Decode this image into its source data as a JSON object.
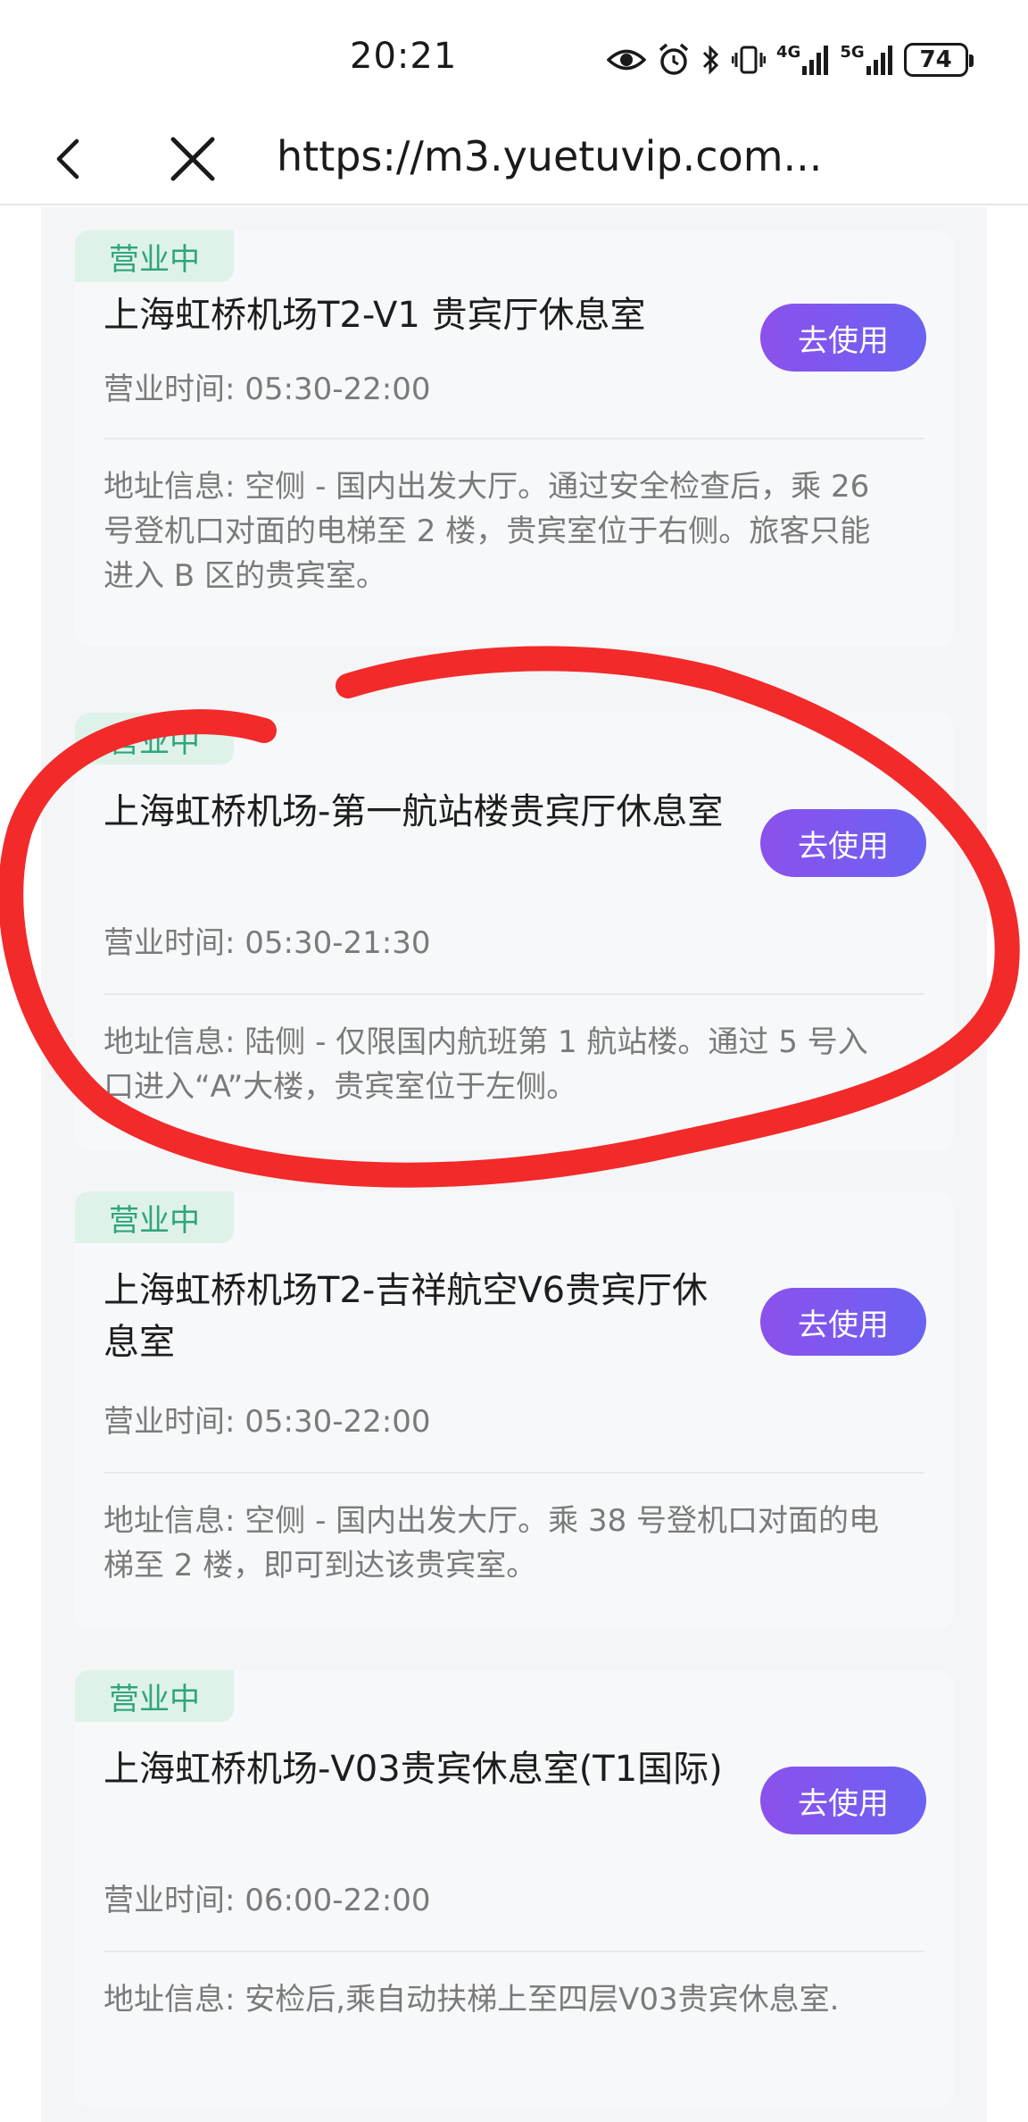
{
  "status_bar": {
    "time": "20:21",
    "icons": [
      "eye-icon",
      "alarm-icon",
      "bluetooth-icon",
      "vibrate-icon",
      "signal-4g-icon",
      "signal-5g-icon"
    ],
    "net1": "4G",
    "net2": "5G",
    "battery": "74"
  },
  "nav": {
    "url": "https://m3.yuetuvip.com..."
  },
  "colors": {
    "badge_bg": "#dff2ea",
    "badge_text": "#2fa57a",
    "button_gradient_start": "#8c50ec",
    "button_gradient_end": "#6b62f2",
    "annotation": "#f22a2a"
  },
  "cards": [
    {
      "status": "营业中",
      "title": "上海虹桥机场T2-V1 贵宾厅休息室",
      "button": "去使用",
      "hours": "营业时间: 05:30-22:00",
      "address": "地址信息: 空侧 - 国内出发大厅。通过安全检查后，乘 26 号登机口对面的电梯至 2 楼，贵宾室位于右侧。旅客只能进入 B 区的贵宾室。"
    },
    {
      "status": "营业中",
      "title": "上海虹桥机场-第一航站楼贵宾厅休息室",
      "button": "去使用",
      "hours": "营业时间: 05:30-21:30",
      "address": "地址信息: 陆侧 - 仅限国内航班第 1 航站楼。通过 5 号入口进入“A”大楼，贵宾室位于左侧。"
    },
    {
      "status": "营业中",
      "title": "上海虹桥机场T2-吉祥航空V6贵宾厅休息室",
      "button": "去使用",
      "hours": "营业时间: 05:30-22:00",
      "address": "地址信息: 空侧 - 国内出发大厅。乘 38 号登机口对面的电梯至 2 楼，即可到达该贵宾室。"
    },
    {
      "status": "营业中",
      "title": "上海虹桥机场-V03贵宾休息室(T1国际)",
      "button": "去使用",
      "hours": "营业时间: 06:00-22:00",
      "address": "地址信息: 安检后,乘自动扶梯上至四层V03贵宾休息室."
    }
  ]
}
